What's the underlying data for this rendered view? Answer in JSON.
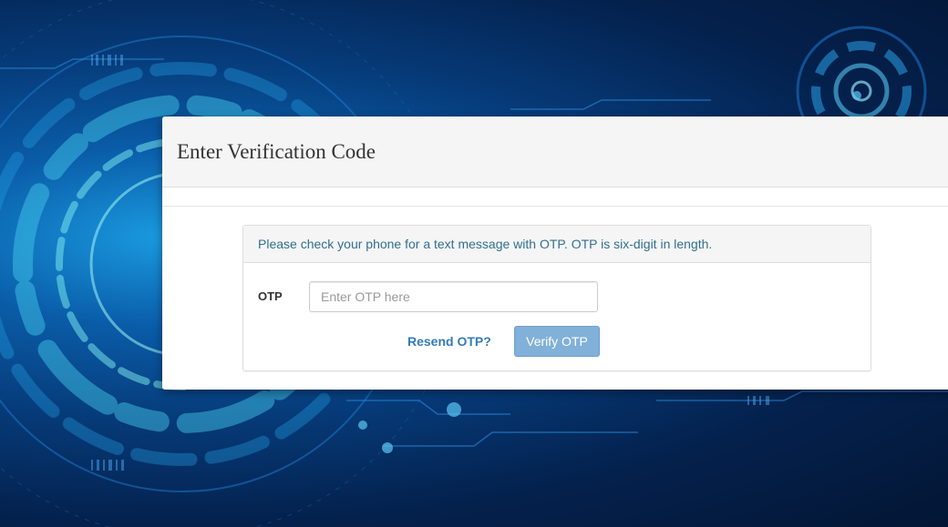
{
  "modal": {
    "title": "Enter Verification Code"
  },
  "panel": {
    "message": "Please check your phone for a text message with OTP. OTP is six-digit in length."
  },
  "form": {
    "otp_label": "OTP",
    "otp_placeholder": "Enter OTP here",
    "otp_value": "",
    "resend_label": "Resend OTP?",
    "verify_label": "Verify OTP",
    "verify_disabled": true
  },
  "colors": {
    "background_dark": "#031634",
    "background_glow": "#1a9be0",
    "link": "#337ab7",
    "info_text": "#31708f",
    "button_disabled": "#81b0d8"
  }
}
